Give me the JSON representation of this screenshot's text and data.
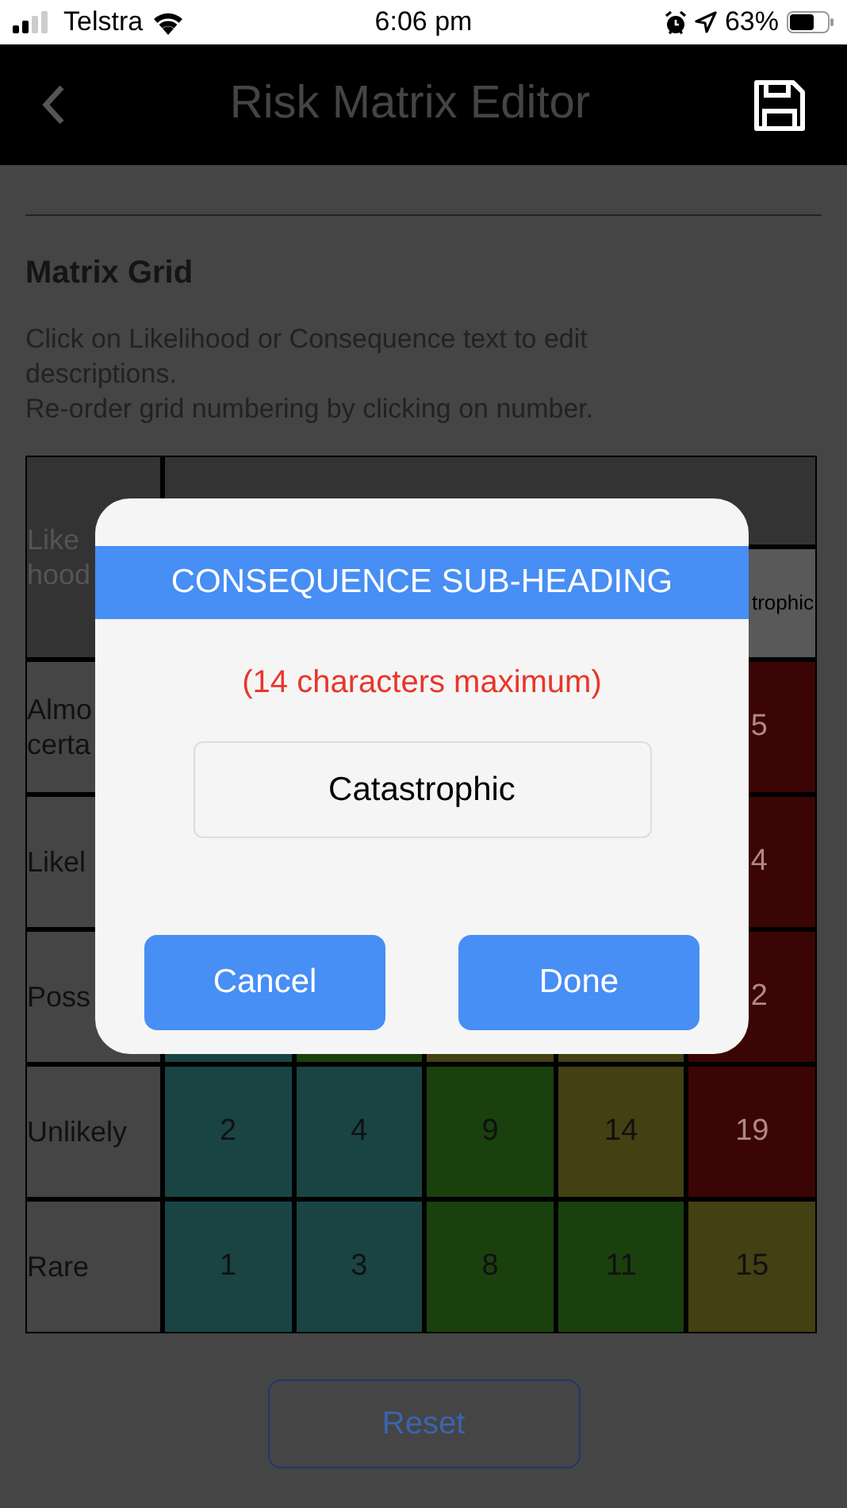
{
  "status_bar": {
    "carrier": "Telstra",
    "time": "6:06 pm",
    "battery": "63%"
  },
  "header": {
    "title": "Risk Matrix Editor"
  },
  "section": {
    "title": "Matrix Grid",
    "description": [
      "Click on Likelihood or Consequence text to edit descriptions.",
      "Re-order grid numbering by clicking on number."
    ]
  },
  "matrix": {
    "corner_label": "Like\nhood",
    "last_sub_heading": {
      "text": "trophic",
      "kind": "partial"
    },
    "rows": [
      {
        "label": "Almo\ncerta",
        "cells": [
          null,
          null,
          null,
          null,
          {
            "text": "5",
            "color": "#3b0505",
            "kind": "partial"
          }
        ]
      },
      {
        "label": "Likel",
        "cells": [
          null,
          null,
          null,
          null,
          {
            "text": "4",
            "color": "#3b0505",
            "kind": "partial"
          }
        ]
      },
      {
        "label": "Poss",
        "cells": [
          {
            "color": "#1a4444"
          },
          {
            "color": "#1a400e"
          },
          {
            "color": "#434013"
          },
          {
            "color": "#434013"
          },
          {
            "text": "2",
            "color": "#3b0505",
            "kind": "partial"
          }
        ]
      },
      {
        "label": "Unlikely",
        "cells": [
          {
            "text": "2",
            "color": "#1a4444"
          },
          {
            "text": "4",
            "color": "#1a4444"
          },
          {
            "text": "9",
            "color": "#1a400e"
          },
          {
            "text": "14",
            "color": "#434013"
          },
          {
            "text": "19",
            "color": "#3b0505"
          }
        ]
      },
      {
        "label": "Rare",
        "cells": [
          {
            "text": "1",
            "color": "#1a4444"
          },
          {
            "text": "3",
            "color": "#1a4444"
          },
          {
            "text": "8",
            "color": "#1a400e"
          },
          {
            "text": "11",
            "color": "#1a400e"
          },
          {
            "text": "15",
            "color": "#434013"
          }
        ]
      }
    ]
  },
  "reset_button": "Reset",
  "dialog": {
    "title": "CONSEQUENCE SUB-HEADING",
    "hint": "(14 characters maximum)",
    "value": "Catastrophic",
    "buttons": [
      "Cancel",
      "Done"
    ]
  }
}
